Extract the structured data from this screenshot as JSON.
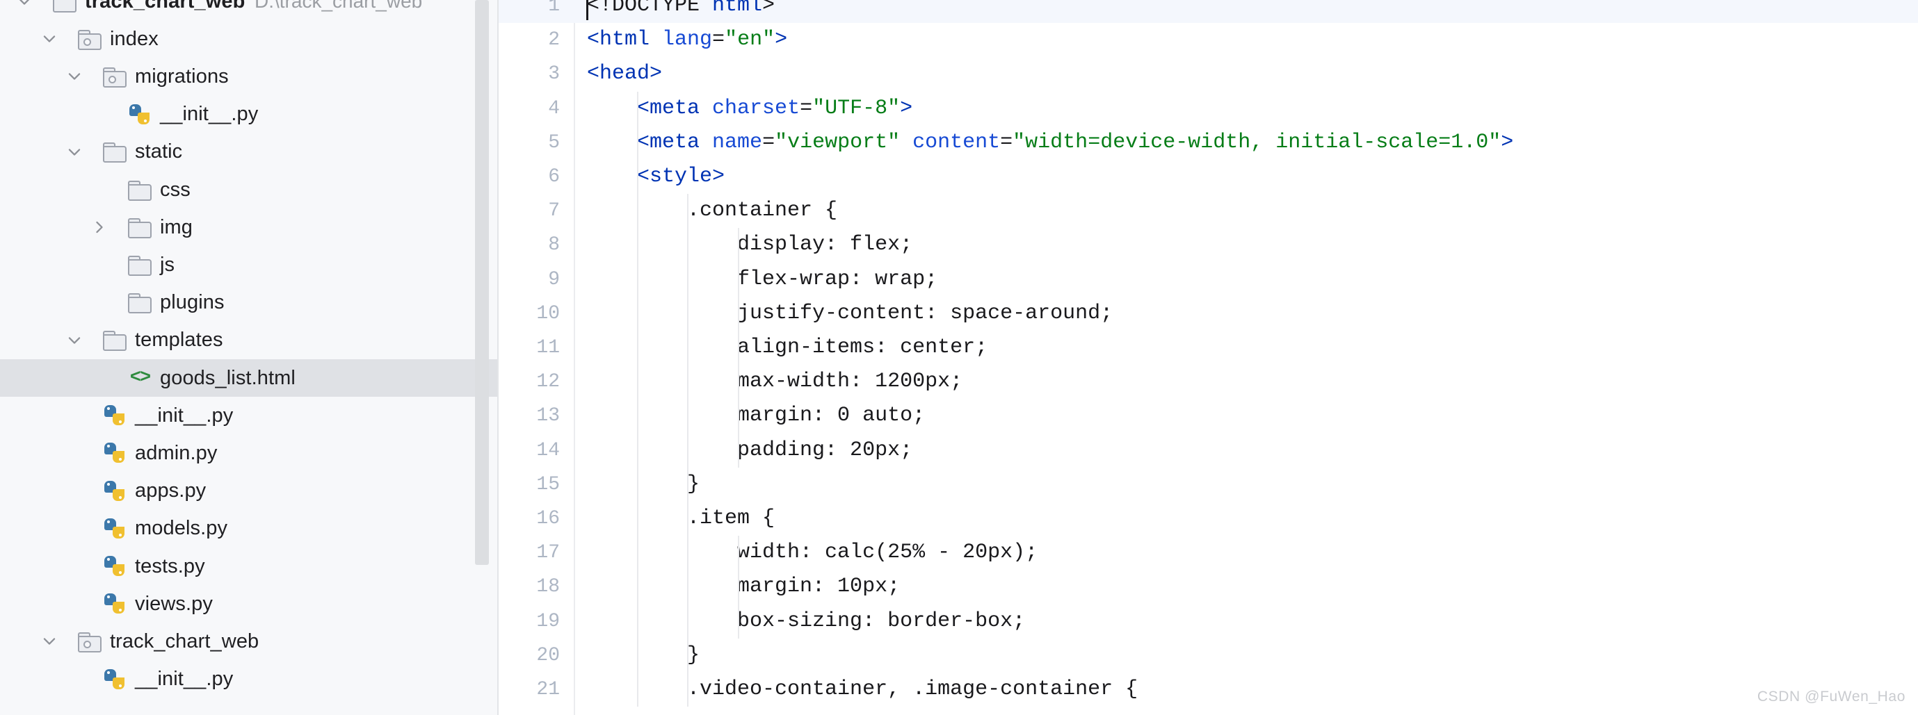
{
  "app": {
    "kind": "pycharm-ide",
    "watermark": "CSDN @FuWen_Hao",
    "colors": {
      "tree_bg": "#f7f8fa",
      "tree_selection": "#dfe1e5",
      "editor_bg": "#ffffff",
      "current_line": "#f4f7fd",
      "line_number": "#adb6c4",
      "tag": "#0033b3",
      "attribute": "#174ad4",
      "string": "#067d17",
      "text": "#19191c",
      "python_blue": "#3c78aa",
      "python_yellow": "#f0c030",
      "html_icon_green": "#2e8b3e"
    }
  },
  "project_tree": {
    "scrollbar": {
      "thumb_top_pct": 0,
      "thumb_height_pct": 79
    },
    "rows": [
      {
        "label": "track_chart_web",
        "path": "D:\\track_chart_web",
        "icon": "folder-plain",
        "arrow": "chevron-down",
        "depth": 0,
        "bold": true,
        "selected": false
      },
      {
        "label": "index",
        "path": "",
        "icon": "folder-module",
        "arrow": "chevron-down",
        "depth": 1,
        "bold": false,
        "selected": false
      },
      {
        "label": "migrations",
        "path": "",
        "icon": "folder-module",
        "arrow": "chevron-down",
        "depth": 2,
        "bold": false,
        "selected": false
      },
      {
        "label": "__init__.py",
        "path": "",
        "icon": "python-file",
        "arrow": "none",
        "depth": 3,
        "bold": false,
        "selected": false
      },
      {
        "label": "static",
        "path": "",
        "icon": "folder-plain",
        "arrow": "chevron-down",
        "depth": 2,
        "bold": false,
        "selected": false
      },
      {
        "label": "css",
        "path": "",
        "icon": "folder-plain",
        "arrow": "none",
        "depth": 3,
        "bold": false,
        "selected": false
      },
      {
        "label": "img",
        "path": "",
        "icon": "folder-plain",
        "arrow": "chevron-right",
        "depth": 3,
        "bold": false,
        "selected": false
      },
      {
        "label": "js",
        "path": "",
        "icon": "folder-plain",
        "arrow": "none",
        "depth": 3,
        "bold": false,
        "selected": false
      },
      {
        "label": "plugins",
        "path": "",
        "icon": "folder-plain",
        "arrow": "none",
        "depth": 3,
        "bold": false,
        "selected": false
      },
      {
        "label": "templates",
        "path": "",
        "icon": "folder-plain",
        "arrow": "chevron-down",
        "depth": 2,
        "bold": false,
        "selected": false
      },
      {
        "label": "goods_list.html",
        "path": "",
        "icon": "html-file",
        "arrow": "none",
        "depth": 3,
        "bold": false,
        "selected": true
      },
      {
        "label": "__init__.py",
        "path": "",
        "icon": "python-file",
        "arrow": "none",
        "depth": 2,
        "bold": false,
        "selected": false
      },
      {
        "label": "admin.py",
        "path": "",
        "icon": "python-file",
        "arrow": "none",
        "depth": 2,
        "bold": false,
        "selected": false
      },
      {
        "label": "apps.py",
        "path": "",
        "icon": "python-file",
        "arrow": "none",
        "depth": 2,
        "bold": false,
        "selected": false
      },
      {
        "label": "models.py",
        "path": "",
        "icon": "python-file",
        "arrow": "none",
        "depth": 2,
        "bold": false,
        "selected": false
      },
      {
        "label": "tests.py",
        "path": "",
        "icon": "python-file",
        "arrow": "none",
        "depth": 2,
        "bold": false,
        "selected": false
      },
      {
        "label": "views.py",
        "path": "",
        "icon": "python-file",
        "arrow": "none",
        "depth": 2,
        "bold": false,
        "selected": false
      },
      {
        "label": "track_chart_web",
        "path": "",
        "icon": "folder-module",
        "arrow": "chevron-down",
        "depth": 1,
        "bold": false,
        "selected": false
      },
      {
        "label": "__init__.py",
        "path": "",
        "icon": "python-file",
        "arrow": "none",
        "depth": 2,
        "bold": false,
        "selected": false
      }
    ]
  },
  "editor": {
    "language": "html",
    "caret_line": 1,
    "first_visible_line": 1,
    "last_visible_line": 21,
    "indent_guides": [
      {
        "line_from": 4,
        "line_to": 21,
        "depth": 1
      },
      {
        "line_from": 7,
        "line_to": 21,
        "depth": 2
      },
      {
        "line_from": 8,
        "line_to": 14,
        "depth": 3
      },
      {
        "line_from": 17,
        "line_to": 19,
        "depth": 3
      }
    ],
    "lines": [
      {
        "n": 1,
        "tokens": [
          {
            "t": "plain",
            "v": "<!DOCTYPE "
          },
          {
            "t": "tag",
            "v": "html"
          },
          {
            "t": "plain",
            "v": ">"
          }
        ]
      },
      {
        "n": 2,
        "tokens": [
          {
            "t": "tag",
            "v": "<html "
          },
          {
            "t": "attr",
            "v": "lang"
          },
          {
            "t": "plain",
            "v": "="
          },
          {
            "t": "str",
            "v": "\"en\""
          },
          {
            "t": "tag",
            "v": ">"
          }
        ]
      },
      {
        "n": 3,
        "tokens": [
          {
            "t": "tag",
            "v": "<head>"
          }
        ]
      },
      {
        "n": 4,
        "tokens": [
          {
            "t": "plain",
            "v": "    "
          },
          {
            "t": "tag",
            "v": "<meta "
          },
          {
            "t": "attr",
            "v": "charset"
          },
          {
            "t": "plain",
            "v": "="
          },
          {
            "t": "str",
            "v": "\"UTF-8\""
          },
          {
            "t": "tag",
            "v": ">"
          }
        ]
      },
      {
        "n": 5,
        "tokens": [
          {
            "t": "plain",
            "v": "    "
          },
          {
            "t": "tag",
            "v": "<meta "
          },
          {
            "t": "attr",
            "v": "name"
          },
          {
            "t": "plain",
            "v": "="
          },
          {
            "t": "str",
            "v": "\"viewport\""
          },
          {
            "t": "plain",
            "v": " "
          },
          {
            "t": "attr",
            "v": "content"
          },
          {
            "t": "plain",
            "v": "="
          },
          {
            "t": "str",
            "v": "\"width=device-width, initial-scale=1.0\""
          },
          {
            "t": "tag",
            "v": ">"
          }
        ]
      },
      {
        "n": 6,
        "tokens": [
          {
            "t": "plain",
            "v": "    "
          },
          {
            "t": "tag",
            "v": "<style>"
          }
        ]
      },
      {
        "n": 7,
        "tokens": [
          {
            "t": "plain",
            "v": "        .container {"
          }
        ]
      },
      {
        "n": 8,
        "tokens": [
          {
            "t": "plain",
            "v": "            display: flex;"
          }
        ]
      },
      {
        "n": 9,
        "tokens": [
          {
            "t": "plain",
            "v": "            flex-wrap: wrap;"
          }
        ]
      },
      {
        "n": 10,
        "tokens": [
          {
            "t": "plain",
            "v": "            justify-content: space-around;"
          }
        ]
      },
      {
        "n": 11,
        "tokens": [
          {
            "t": "plain",
            "v": "            align-items: center;"
          }
        ]
      },
      {
        "n": 12,
        "tokens": [
          {
            "t": "plain",
            "v": "            max-width: 1200px;"
          }
        ]
      },
      {
        "n": 13,
        "tokens": [
          {
            "t": "plain",
            "v": "            margin: 0 auto;"
          }
        ]
      },
      {
        "n": 14,
        "tokens": [
          {
            "t": "plain",
            "v": "            padding: 20px;"
          }
        ]
      },
      {
        "n": 15,
        "tokens": [
          {
            "t": "plain",
            "v": "        }"
          }
        ]
      },
      {
        "n": 16,
        "tokens": [
          {
            "t": "plain",
            "v": "        .item {"
          }
        ]
      },
      {
        "n": 17,
        "tokens": [
          {
            "t": "plain",
            "v": "            width: calc(25% - 20px);"
          }
        ]
      },
      {
        "n": 18,
        "tokens": [
          {
            "t": "plain",
            "v": "            margin: 10px;"
          }
        ]
      },
      {
        "n": 19,
        "tokens": [
          {
            "t": "plain",
            "v": "            box-sizing: border-box;"
          }
        ]
      },
      {
        "n": 20,
        "tokens": [
          {
            "t": "plain",
            "v": "        }"
          }
        ]
      },
      {
        "n": 21,
        "tokens": [
          {
            "t": "plain",
            "v": "        .video-container, .image-container {"
          }
        ]
      }
    ]
  }
}
